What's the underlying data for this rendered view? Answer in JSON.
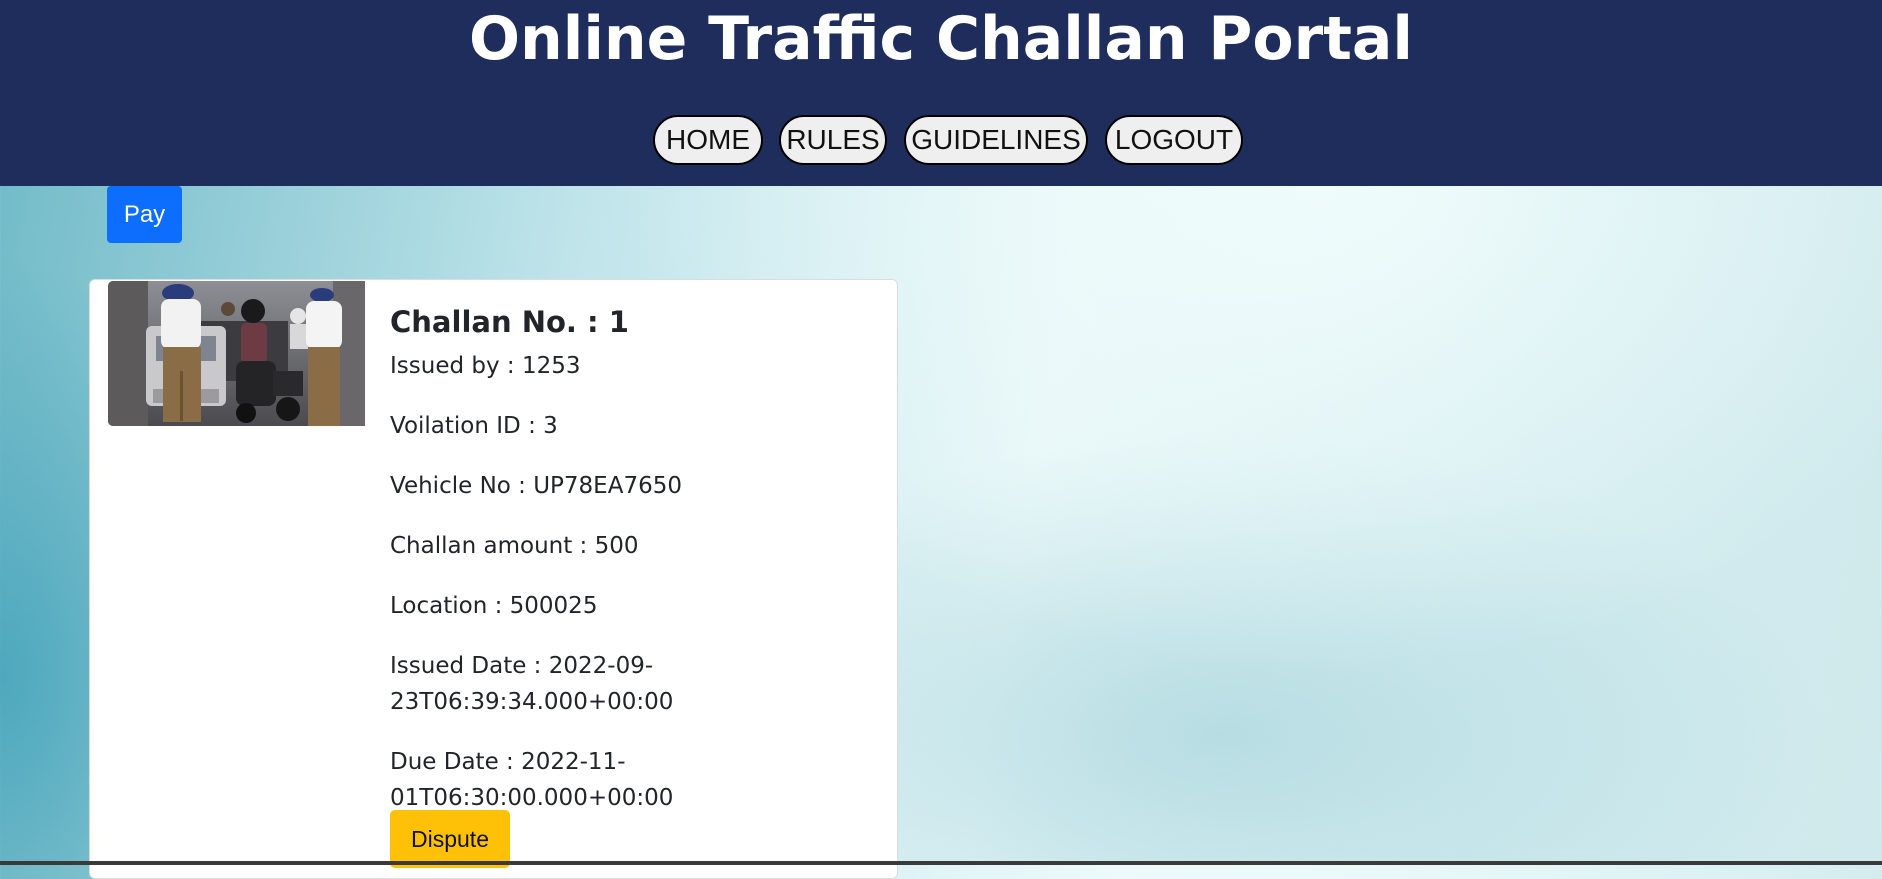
{
  "header": {
    "title": "Online Traffic Challan Portal",
    "background": "#1f2d5c",
    "nav": {
      "home": "HOME",
      "rules": "RULES",
      "guidelines": "GUIDELINES",
      "logout": "LOGOUT"
    }
  },
  "actions": {
    "pay_label": "Pay",
    "pay_color": "#0d6efd"
  },
  "challan": {
    "title": "Challan No. : 1",
    "issued_by": "Issued by : 1253",
    "violation_id": "Voilation ID : 3",
    "vehicle_no": "Vehicle No : UP78EA7650",
    "amount": "Challan amount : 500",
    "location": "Location : 500025",
    "issued_date": "Issued Date : 2022-09-23T06:39:34.000+00:00",
    "due_date": "Due Date : 2022-11-01T06:30:00.000+00:00",
    "dispute_label": "Dispute",
    "dispute_color": "#ffc107",
    "image_icon": "traffic-police-photo"
  }
}
